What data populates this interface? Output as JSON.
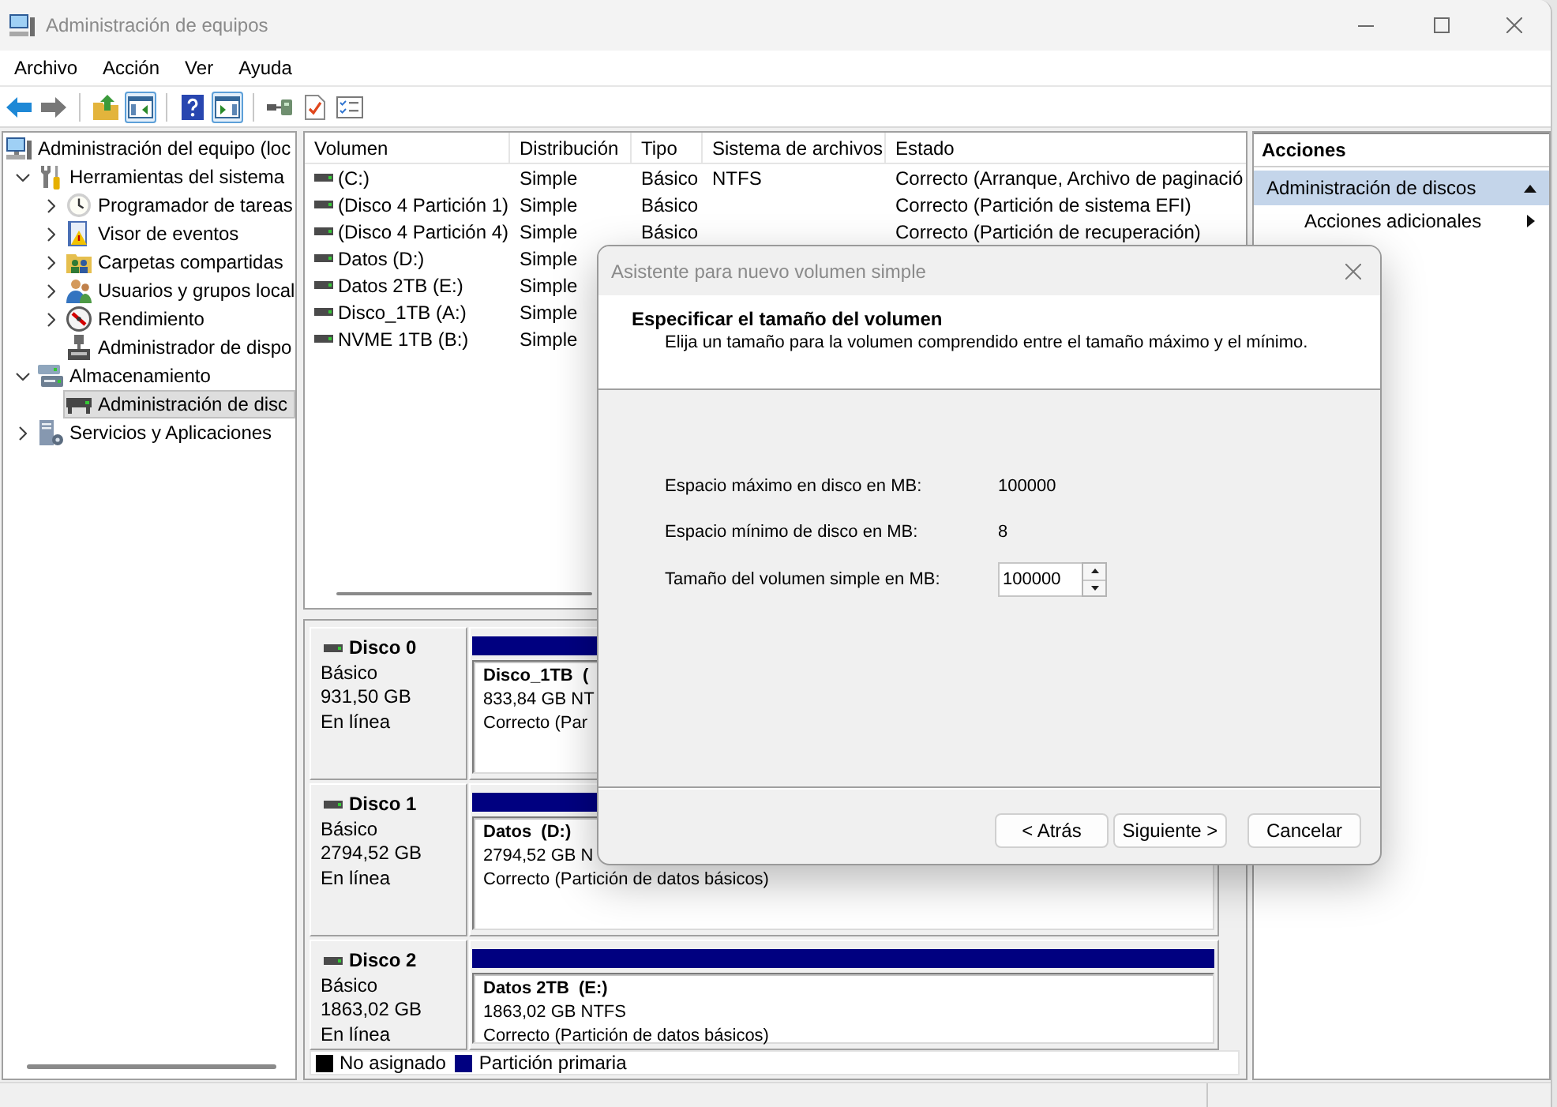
{
  "window": {
    "title": "Administración de equipos"
  },
  "menu": [
    "Archivo",
    "Acción",
    "Ver",
    "Ayuda"
  ],
  "toolbar": [
    {
      "buttons": [
        {
          "kind": "back",
          "on": false,
          "disabled": false
        },
        {
          "kind": "forward",
          "on": false,
          "disabled": true
        }
      ]
    },
    {
      "buttons": [
        {
          "kind": "up",
          "on": false,
          "disabled": false
        },
        {
          "kind": "tree",
          "on": true,
          "disabled": false
        }
      ]
    },
    {
      "buttons": [
        {
          "kind": "help",
          "on": false,
          "disabled": false
        },
        {
          "kind": "actions",
          "on": true,
          "disabled": false
        }
      ]
    },
    {
      "buttons": [
        {
          "kind": "connect",
          "on": false,
          "disabled": false
        },
        {
          "kind": "check",
          "on": false,
          "disabled": false
        },
        {
          "kind": "list",
          "on": false,
          "disabled": false
        }
      ]
    }
  ],
  "tree": [
    {
      "label": "Administración del equipo (loc",
      "kind": "computer",
      "selected": false,
      "children": [
        {
          "label": "Herramientas del sistema",
          "kind": "tools",
          "expanded": true,
          "selected": false,
          "children": [
            {
              "label": "Programador de tareas",
              "kind": "clock",
              "expanded": false,
              "selected": false
            },
            {
              "label": "Visor de eventos",
              "kind": "events",
              "expanded": false,
              "selected": false
            },
            {
              "label": "Carpetas compartidas",
              "kind": "shares",
              "expanded": false,
              "selected": false
            },
            {
              "label": "Usuarios y grupos local",
              "kind": "users",
              "expanded": false,
              "selected": false
            },
            {
              "label": "Rendimiento",
              "kind": "performance",
              "expanded": false,
              "selected": false
            },
            {
              "label": "Administrador de dispo",
              "kind": "devices",
              "selected": false
            }
          ]
        },
        {
          "label": "Almacenamiento",
          "kind": "storage",
          "expanded": true,
          "selected": false,
          "children": [
            {
              "label": "Administración de disc",
              "kind": "disk",
              "selected": true
            }
          ]
        },
        {
          "label": "Servicios y Aplicaciones",
          "kind": "services",
          "expanded": false,
          "selected": false
        }
      ]
    }
  ],
  "volumes": {
    "columns": [
      "Volumen",
      "Distribución",
      "Tipo",
      "Sistema de archivos",
      "Estado"
    ],
    "rows": [
      {
        "volume": "(C:)",
        "layout": "Simple",
        "type": "Básico",
        "file_system": "NTFS",
        "status": "Correcto (Arranque, Archivo de paginació"
      },
      {
        "volume": "(Disco 4 Partición 1)",
        "layout": "Simple",
        "type": "Básico",
        "status": "Correcto (Partición de sistema EFI)"
      },
      {
        "volume": "(Disco 4 Partición 4)",
        "layout": "Simple",
        "type": "Básico",
        "status": "Correcto (Partición de recuperación)"
      },
      {
        "volume": "Datos (D:)",
        "layout": "Simple"
      },
      {
        "volume": "Datos 2TB (E:)",
        "layout": "Simple"
      },
      {
        "volume": "Disco_1TB (A:)",
        "layout": "Simple"
      },
      {
        "volume": "NVME 1TB (B:)",
        "layout": "Simple"
      }
    ]
  },
  "disks": [
    {
      "name": "Disco 0",
      "type": "Básico",
      "size": "931,50 GB",
      "status": "En línea",
      "partitions": [
        {
          "name": "Disco_1TB  (",
          "size": "833,84 GB NT",
          "status": "Correcto (Par",
          "color": "#000080"
        }
      ]
    },
    {
      "name": "Disco 1",
      "type": "Básico",
      "size": "2794,52 GB",
      "status": "En línea",
      "partitions": [
        {
          "name": "Datos  (D:)",
          "size": "2794,52 GB N",
          "status": "Correcto (Partición de datos básicos)",
          "color": "#000080"
        }
      ]
    },
    {
      "name": "Disco 2",
      "type": "Básico",
      "size": "1863,02 GB",
      "status": "En línea",
      "partitions": [
        {
          "name": "Datos 2TB  (E:)",
          "size": "1863,02 GB NTFS",
          "status": "Correcto (Partición de datos básicos)",
          "color": "#000080"
        }
      ]
    }
  ],
  "legend": [
    {
      "label": "No asignado",
      "color": "#000000"
    },
    {
      "label": "Partición primaria",
      "color": "#000080"
    }
  ],
  "actions": {
    "title": "Acciones",
    "sections": [
      {
        "label": "Administración de discos",
        "expanded": true,
        "items": [
          {
            "label": "Acciones adicionales",
            "kind": "submenu"
          }
        ]
      }
    ]
  },
  "dialog": {
    "title": "Asistente para nuevo volumen simple",
    "heading": "Especificar el tamaño del volumen",
    "subheading": "Elija un tamaño para la volumen comprendido entre el tamaño máximo y el mínimo.",
    "fields": [
      {
        "kind": "readout",
        "label": "Espacio máximo en disco en MB:",
        "value": "100000"
      },
      {
        "kind": "readout",
        "label": "Espacio mínimo de disco en MB:",
        "value": "8"
      },
      {
        "kind": "spinner",
        "label": "Tamaño del volumen simple en MB:",
        "value": "100000"
      }
    ],
    "buttons": [
      {
        "label": "< Atrás"
      },
      {
        "label": "Siguiente >"
      },
      {
        "label": "Cancelar"
      }
    ]
  }
}
